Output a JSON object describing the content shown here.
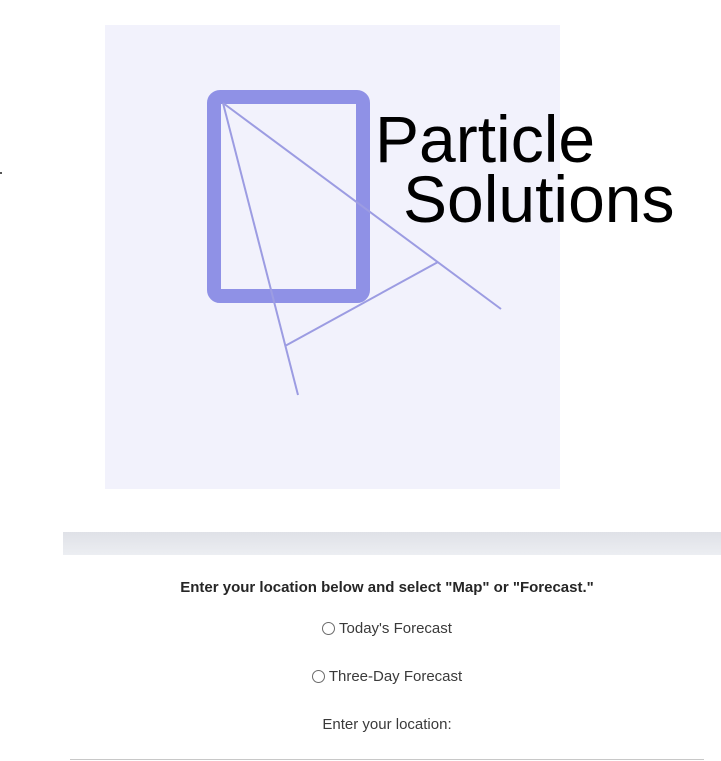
{
  "logo": {
    "line1": "Particle",
    "line2": "Solutions",
    "accent_color": "#8f91e6",
    "line_color": "#9c9ce2",
    "panel_color": "#f2f2fc",
    "icon": "particle-solutions-logo-icon"
  },
  "form": {
    "instructions": "Enter your location below and select \"Map\" or \"Forecast.\"",
    "options": [
      {
        "label": "Today's Forecast"
      },
      {
        "label": "Three-Day Forecast"
      }
    ],
    "location_label": "Enter your location:",
    "location_value": "",
    "location_placeholder": ""
  }
}
